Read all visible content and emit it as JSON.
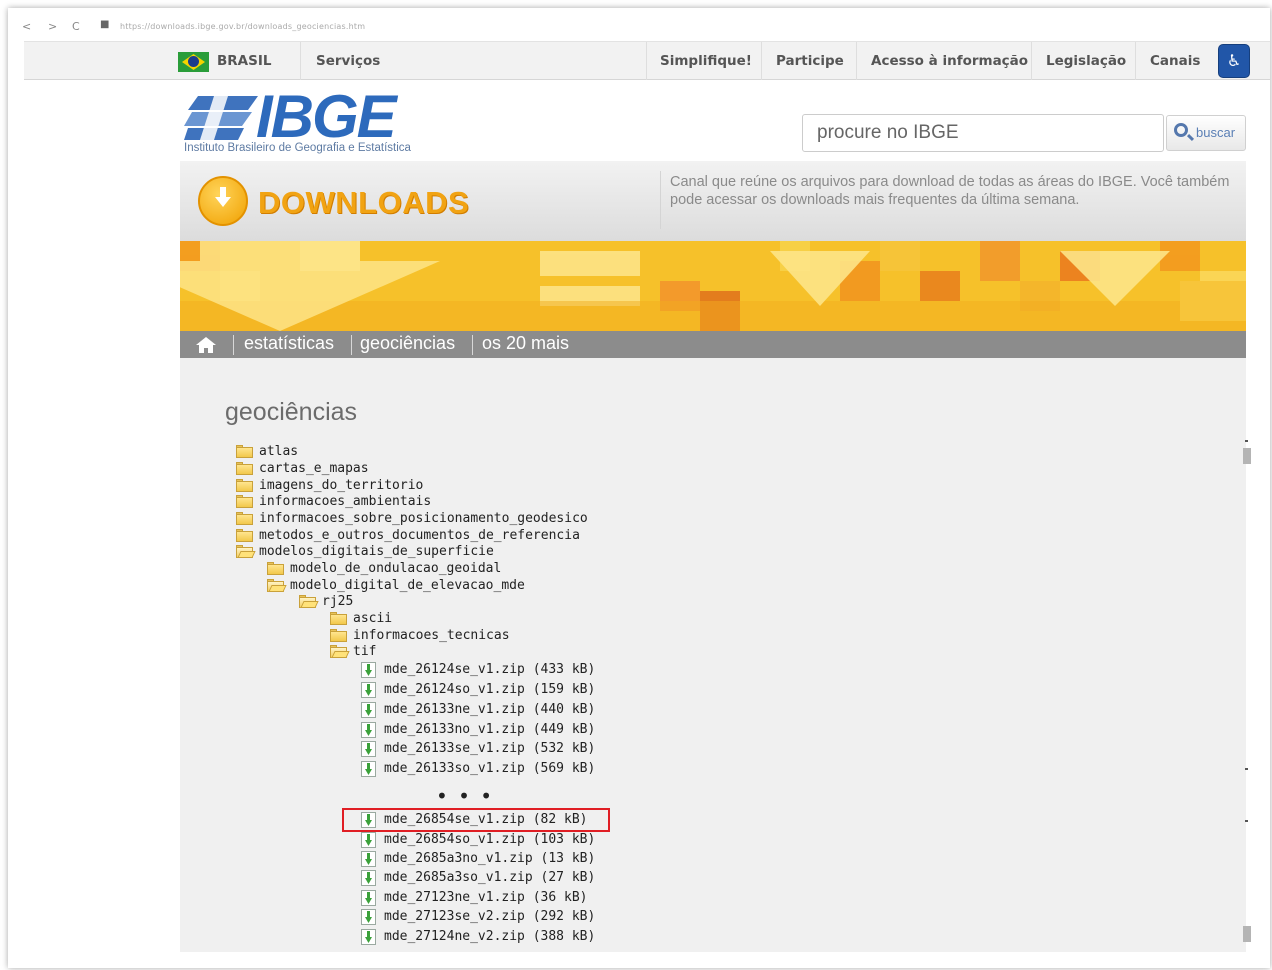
{
  "browser": {
    "url": "https://downloads.ibge.gov.br/downloads_geociencias.htm",
    "back": "<",
    "forward": ">",
    "reload": "C"
  },
  "gov_bar": {
    "brasil": "BRASIL",
    "servicos": "Serviços",
    "simplifique": "Simplifique!",
    "participe": "Participe",
    "acesso": "Acesso à informação",
    "legislacao": "Legislação",
    "canais": "Canais"
  },
  "logo": {
    "word": "IBGE",
    "subtitle": "Instituto Brasileiro de Geografia e Estatística"
  },
  "search": {
    "placeholder": "procure no IBGE",
    "button": "buscar"
  },
  "downloads": {
    "title": "DOWNLOADS",
    "description": "Canal que reúne os arquivos para download de todas as áreas do IBGE. Você também pode acessar os downloads mais frequentes da última semana."
  },
  "nav": {
    "estatisticas": "estatísticas",
    "geociencias": "geociências",
    "os20": "os 20 mais"
  },
  "page_title": "geociências",
  "tree": {
    "atlas": "atlas",
    "cartas": "cartas_e_mapas",
    "imagens": "imagens_do_territorio",
    "ambientais": "informacoes_ambientais",
    "posicionamento": "informacoes_sobre_posicionamento_geodesico",
    "metodos": "metodos_e_outros_documentos_de_referencia",
    "modelos": "modelos_digitais_de_superficie",
    "ondulacao": "modelo_de_ondulacao_geoidal",
    "mde": "modelo_digital_de_elevacao_mde",
    "rj25": "rj25",
    "ascii": "ascii",
    "tecnicas": "informacoes_tecnicas",
    "tif": "tif"
  },
  "files": [
    "mde_26124se_v1.zip (433 kB)",
    "mde_26124so_v1.zip (159 kB)",
    "mde_26133ne_v1.zip (440 kB)",
    "mde_26133no_v1.zip (449 kB)",
    "mde_26133se_v1.zip (532 kB)",
    "mde_26133so_v1.zip (569 kB)",
    "mde_26854se_v1.zip (82 kB)",
    "mde_26854so_v1.zip (103 kB)",
    "mde_2685a3no_v1.zip (13 kB)",
    "mde_2685a3so_v1.zip (27 kB)",
    "mde_27123ne_v1.zip (36 kB)",
    "mde_27123se_v2.zip (292 kB)",
    "mde_27124ne_v2.zip (388 kB)"
  ],
  "ellipsis": "• • •",
  "colors": {
    "ibge_blue": "#2d6abc",
    "downloads_orange": "#f1a313",
    "highlight_red": "#e01e24",
    "nav_gray": "#8c8c8c"
  }
}
